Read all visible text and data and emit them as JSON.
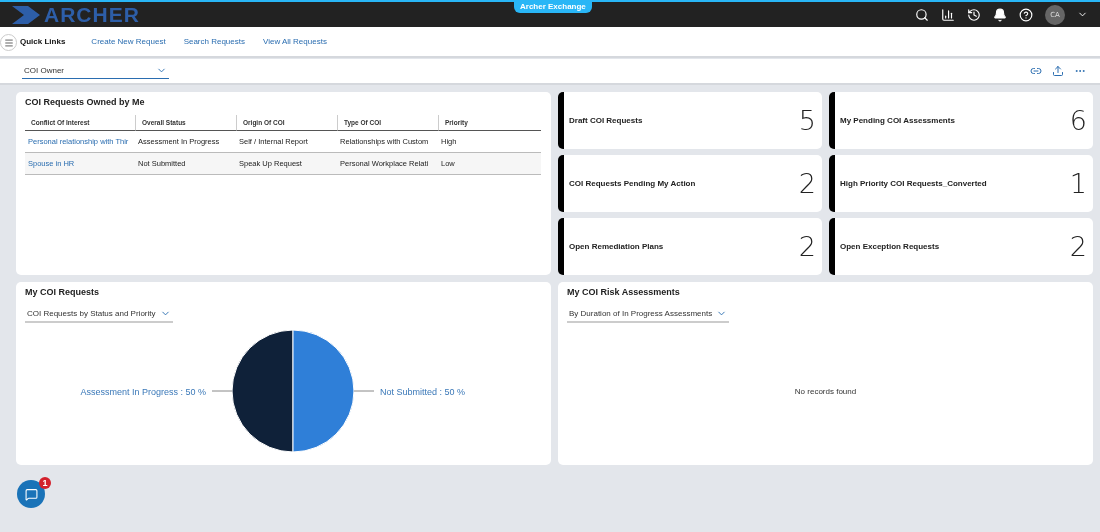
{
  "header": {
    "logo": "ARCHER",
    "exchange_tab": "Archer Exchange",
    "avatar": "CA"
  },
  "quick_links": {
    "title": "Quick Links",
    "links": [
      "Create New Request",
      "Search Requests",
      "View All Requests"
    ]
  },
  "filter": {
    "value": "COI Owner"
  },
  "owned_table": {
    "title": "COI Requests Owned by Me",
    "columns": [
      "Conflict Of Interest",
      "Overall Status",
      "Origin Of COI",
      "Type Of COI",
      "Priority"
    ],
    "rows": [
      [
        "Personal relationship with Thir",
        "Assessment In Progress",
        "Self / Internal Report",
        "Relationships with Custom",
        "High"
      ],
      [
        "Spouse in HR",
        "Not Submitted",
        "Speak Up Request",
        "Personal Workplace Relati",
        "Low"
      ]
    ]
  },
  "tiles": [
    {
      "label": "Draft COI Requests",
      "count": "5"
    },
    {
      "label": "My Pending COI Assessments",
      "count": "6"
    },
    {
      "label": "COI Requests Pending My Action",
      "count": "2"
    },
    {
      "label": "High Priority COI Requests_Converted",
      "count": "1"
    },
    {
      "label": "Open Remediation Plans",
      "count": "2"
    },
    {
      "label": "Open Exception Requests",
      "count": "2"
    }
  ],
  "my_requests": {
    "title": "My COI Requests",
    "view": "COI Requests by Status and Priority",
    "chart_data": {
      "type": "pie",
      "categories": [
        "Assessment In Progress : 50 %",
        "Not Submitted : 50 %"
      ],
      "values": [
        50,
        50
      ],
      "colors": [
        "#0f2139",
        "#2f7fd8"
      ]
    }
  },
  "risk_assessments": {
    "title": "My COI Risk Assessments",
    "view": "By Duration of In Progress Assessments",
    "empty_text": "No records found"
  },
  "chat": {
    "badge": "1"
  }
}
